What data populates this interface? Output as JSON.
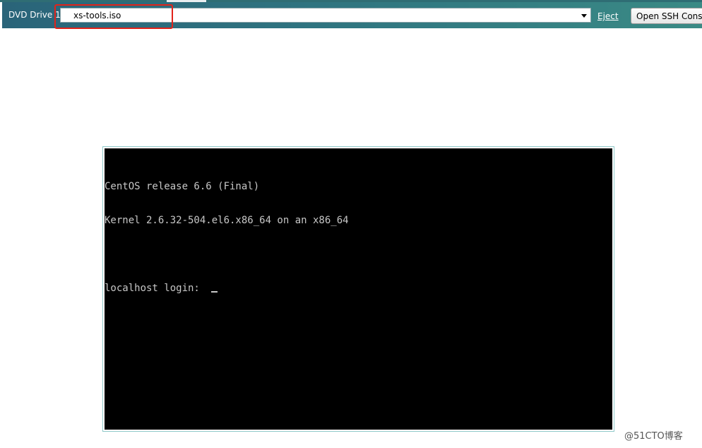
{
  "toolbar": {
    "dvd_label": "DVD Drive 1:",
    "iso_selected": "xs-tools.iso",
    "eject_label": "Eject",
    "ssh_button_label": "Open SSH Console"
  },
  "console": {
    "lines": [
      "CentOS release 6.6 (Final)",
      "Kernel 2.6.32-504.el6.x86_64 on an x86_64",
      "",
      "localhost login: "
    ]
  },
  "watermark": "@51CTO博客",
  "colors": {
    "toolbar": "#2f7480",
    "highlight": "#e2231a",
    "console_bg": "#000000",
    "console_text": "#c7c7c7"
  },
  "icons": {
    "dropdown": "chevron-down-icon"
  }
}
